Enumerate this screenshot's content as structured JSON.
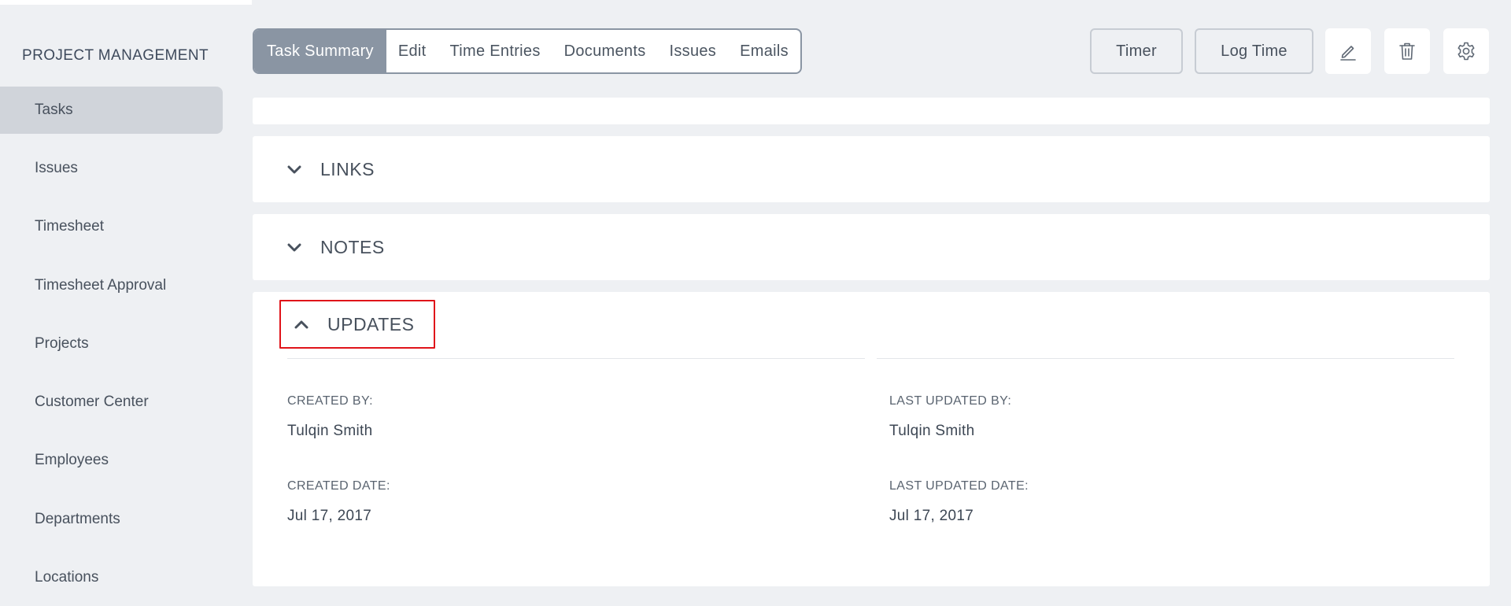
{
  "sidebar": {
    "heading": "PROJECT MANAGEMENT",
    "items": [
      {
        "label": "Tasks",
        "active": true
      },
      {
        "label": "Issues"
      },
      {
        "label": "Timesheet"
      },
      {
        "label": "Timesheet Approval"
      },
      {
        "label": "Projects"
      },
      {
        "label": "Customer Center"
      },
      {
        "label": "Employees"
      },
      {
        "label": "Departments"
      },
      {
        "label": "Locations"
      }
    ]
  },
  "tabs": [
    {
      "label": "Task Summary",
      "active": true
    },
    {
      "label": "Edit"
    },
    {
      "label": "Time Entries"
    },
    {
      "label": "Documents"
    },
    {
      "label": "Issues"
    },
    {
      "label": "Emails"
    }
  ],
  "toolbar": {
    "timer_label": "Timer",
    "log_time_label": "Log Time",
    "icons": [
      "pencil-icon",
      "trash-icon",
      "gear-icon"
    ]
  },
  "sections": {
    "links": {
      "title": "LINKS",
      "expanded": false
    },
    "notes": {
      "title": "NOTES",
      "expanded": false
    },
    "updates": {
      "title": "UPDATES",
      "expanded": true,
      "created_by_label": "CREATED BY:",
      "created_by": "Tulqin Smith",
      "created_date_label": "CREATED DATE:",
      "created_date": "Jul 17, 2017",
      "last_updated_by_label": "LAST UPDATED BY:",
      "last_updated_by": "Tulqin Smith",
      "last_updated_date_label": "LAST UPDATED DATE:",
      "last_updated_date": "Jul 17, 2017"
    }
  },
  "colors": {
    "active_tab": "#8a95a3",
    "highlight": "#e0141a",
    "background": "#eef0f3"
  }
}
